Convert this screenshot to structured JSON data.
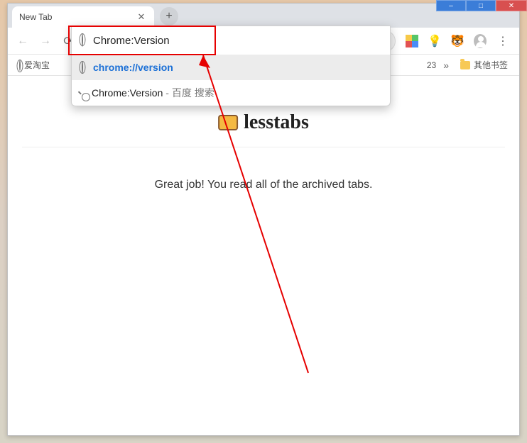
{
  "window_controls": {
    "min": "–",
    "max": "□",
    "close": "✕"
  },
  "tab": {
    "title": "New Tab"
  },
  "newtab_glyph": "+",
  "nav": {
    "back": "←",
    "forward": "→",
    "reload": "⟳"
  },
  "omnibox": {
    "input_value": "Chrome:Version",
    "suggestions": [
      {
        "kind": "url",
        "text": "chrome://version"
      },
      {
        "kind": "search",
        "text": "Chrome:Version",
        "desc": " - 百度 搜索"
      }
    ]
  },
  "extensions": {
    "drive_colors": [
      "#f7c948",
      "#56c568",
      "#e25252",
      "#4a8cf7"
    ],
    "bulb": "💡",
    "tiger": "🐯"
  },
  "menu_glyph": "⋮",
  "bookmarks": {
    "item1": "爱淘宝",
    "right_text": "23",
    "overflow": "»",
    "other": "其他书签"
  },
  "page": {
    "brand": "lesstabs",
    "message": "Great job! You read all of the archived tabs."
  }
}
